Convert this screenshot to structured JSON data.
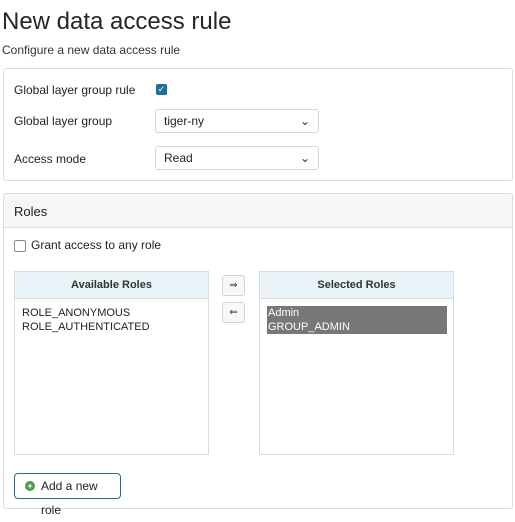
{
  "page": {
    "title": "New data access rule",
    "subtitle": "Configure a new data access rule"
  },
  "form": {
    "global_layer_group_rule_label": "Global layer group rule",
    "global_layer_group_rule_checked": true,
    "global_layer_group_label": "Global layer group",
    "global_layer_group_value": "tiger-ny",
    "access_mode_label": "Access mode",
    "access_mode_value": "Read"
  },
  "roles": {
    "section_title": "Roles",
    "grant_any_role_label": "Grant access to any role",
    "grant_any_role_checked": false,
    "available_header": "Available Roles",
    "available_items": [
      "ROLE_ANONYMOUS",
      "ROLE_AUTHENTICATED"
    ],
    "selected_header": "Selected Roles",
    "selected_items": [
      "Admin",
      "GROUP_ADMIN"
    ],
    "move_right_icon": "⇒",
    "move_left_icon": "⇐",
    "add_role_label": "Add a new role"
  },
  "colors": {
    "accent": "#1f6e9b",
    "selected_item_bg": "#777777",
    "add_icon": "#4f9a48"
  }
}
